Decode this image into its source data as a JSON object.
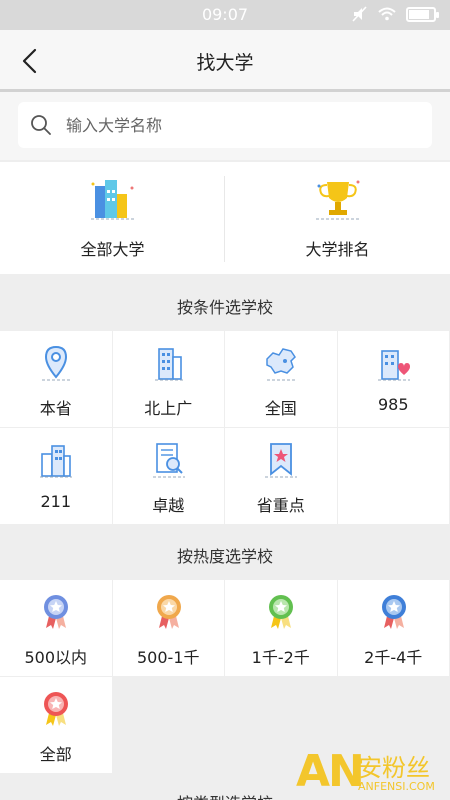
{
  "status_bar": {
    "time": "09:07"
  },
  "nav": {
    "title": "找大学"
  },
  "search": {
    "placeholder": "输入大学名称"
  },
  "top_categories": [
    {
      "label": "全部大学",
      "icon": "bar-chart-icon"
    },
    {
      "label": "大学排名",
      "icon": "trophy-icon"
    }
  ],
  "sections": {
    "by_condition": {
      "title": "按条件选学校",
      "items": [
        {
          "label": "本省",
          "icon": "location-pin-icon"
        },
        {
          "label": "北上广",
          "icon": "city-buildings-icon"
        },
        {
          "label": "全国",
          "icon": "china-map-icon"
        },
        {
          "label": "985",
          "icon": "building-heart-icon"
        },
        {
          "label": "211",
          "icon": "school-buildings-icon"
        },
        {
          "label": "卓越",
          "icon": "document-search-icon"
        },
        {
          "label": "省重点",
          "icon": "bookmark-star-icon"
        }
      ]
    },
    "by_popularity": {
      "title": "按热度选学校",
      "items": [
        {
          "label": "500以内",
          "icon": "medal-icon",
          "color": "#6f8fe0"
        },
        {
          "label": "500-1千",
          "icon": "medal-icon",
          "color": "#f0a84c"
        },
        {
          "label": "1千-2千",
          "icon": "medal-icon",
          "color": "#62c050"
        },
        {
          "label": "2千-4千",
          "icon": "medal-icon",
          "color": "#3f7fd8"
        },
        {
          "label": "全部",
          "icon": "medal-icon",
          "color": "#ee5555"
        }
      ]
    },
    "by_type": {
      "title": "按类型选学校"
    }
  },
  "watermark": {
    "letters": "AN",
    "chinese": "安粉丝",
    "url": "ANFENSI.COM"
  },
  "colors": {
    "accent_blue": "#4a90e2",
    "accent_yellow": "#f5c518",
    "watermark": "#f3c62c"
  }
}
